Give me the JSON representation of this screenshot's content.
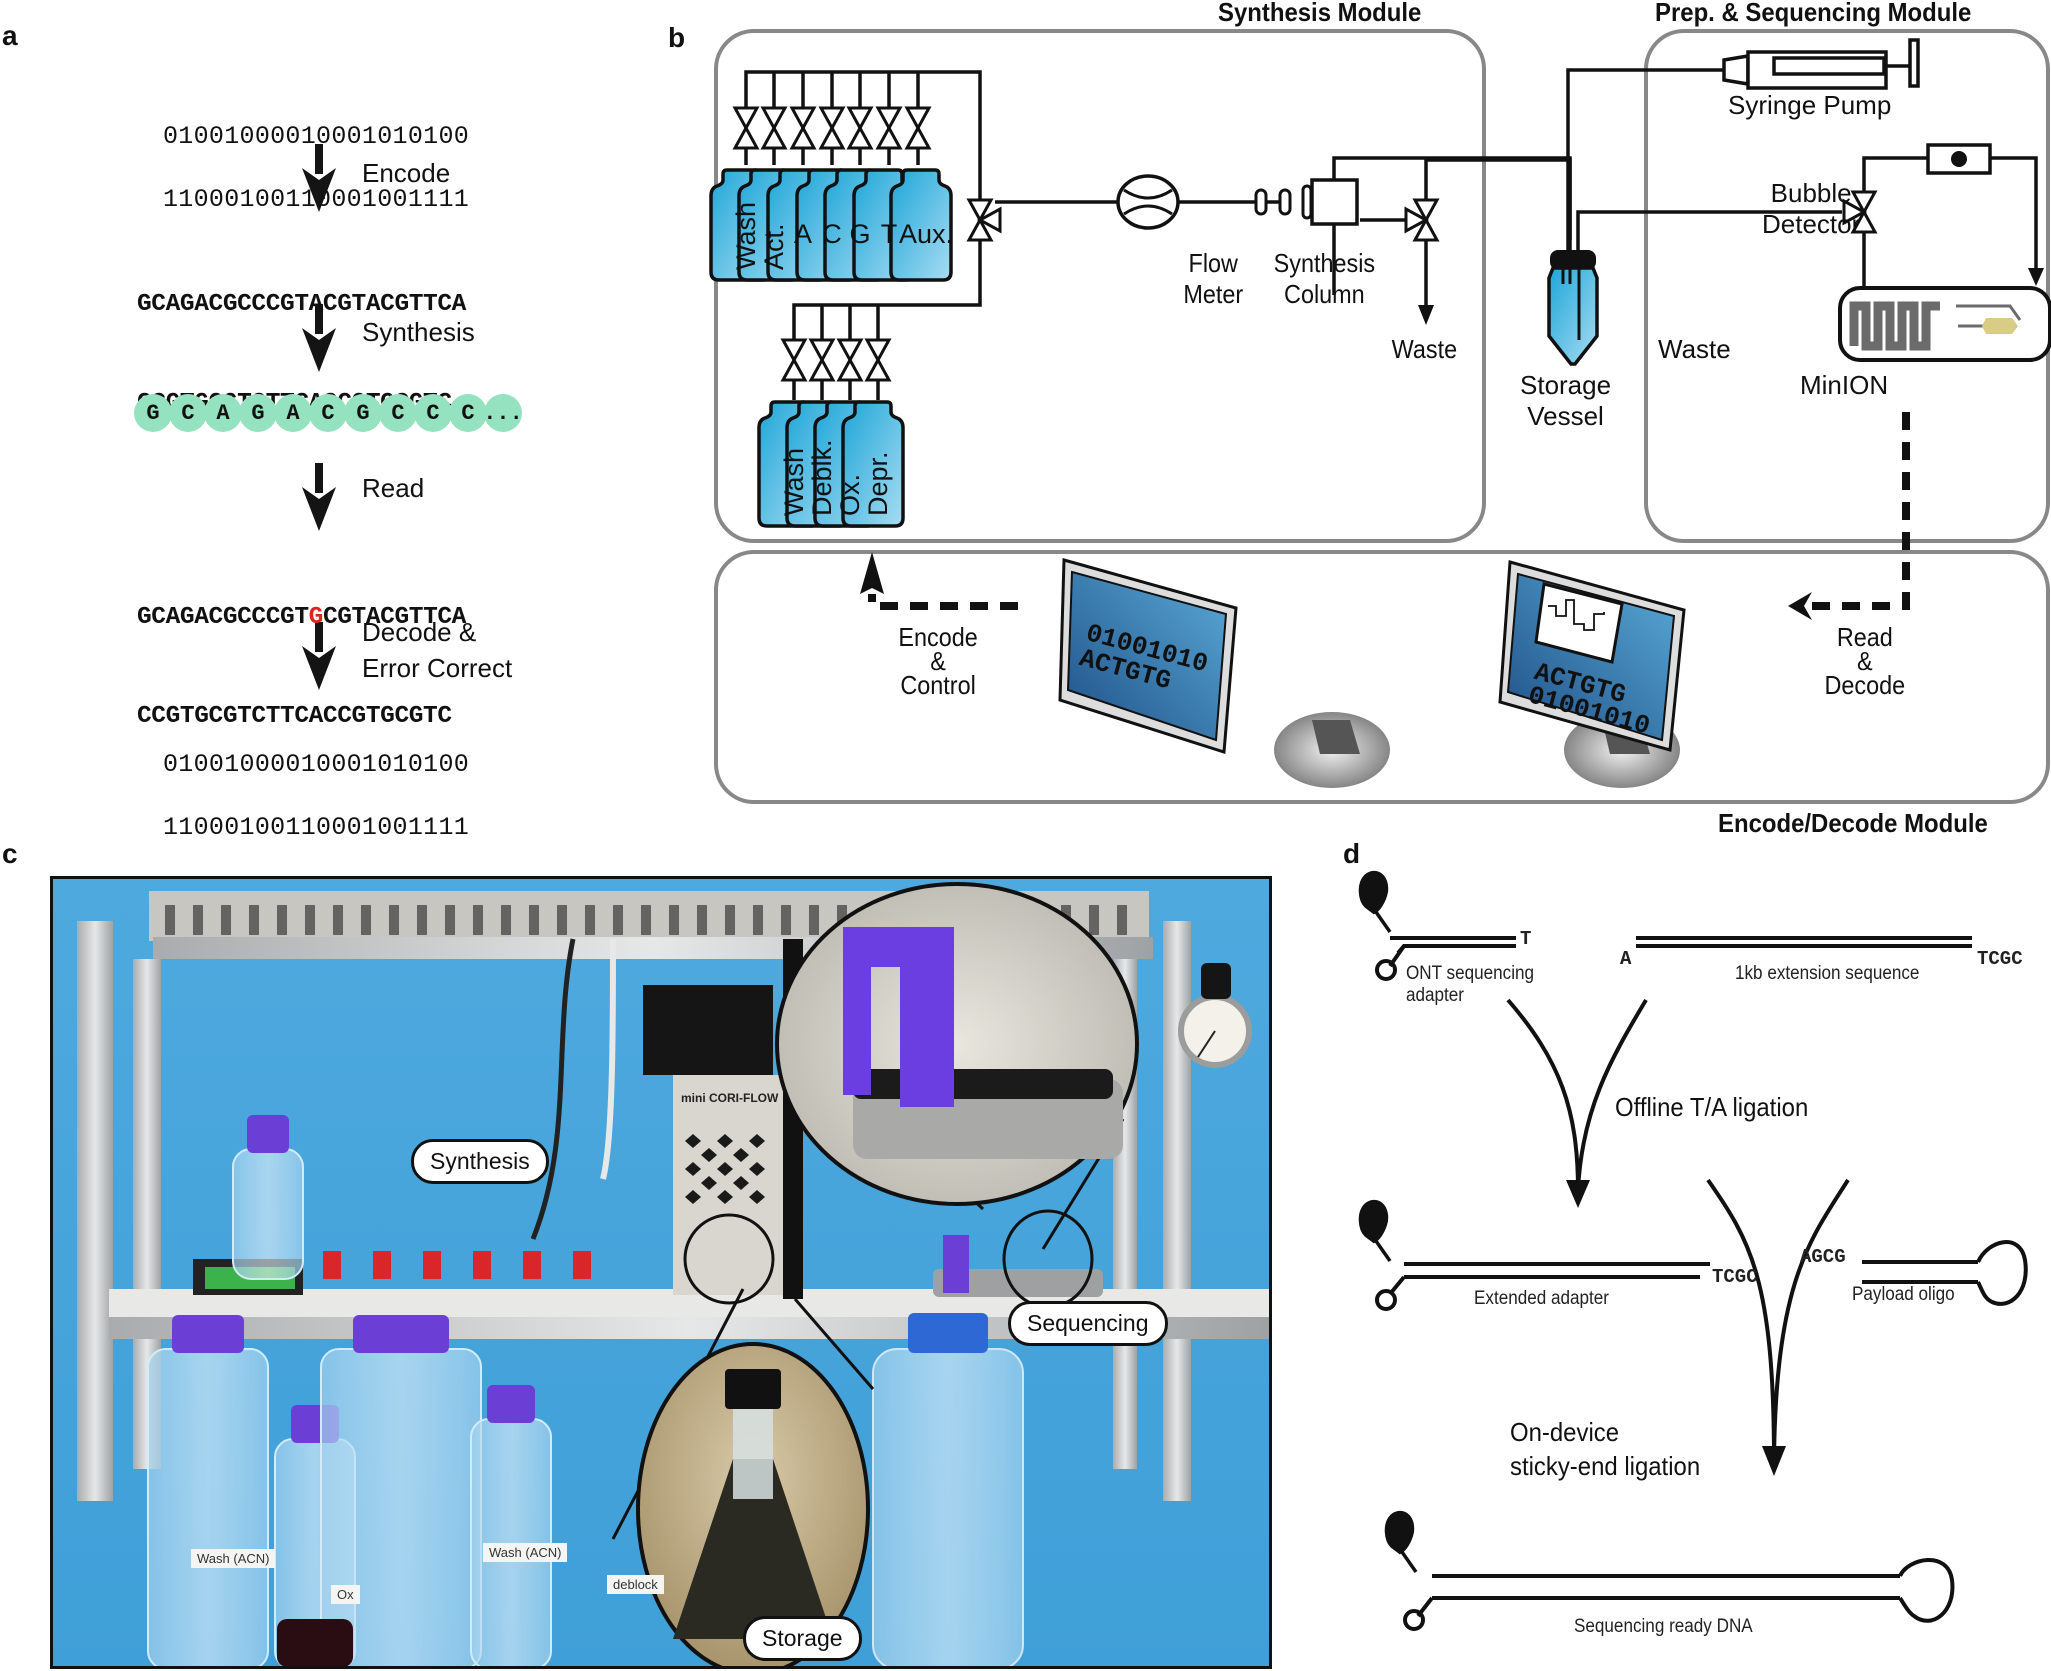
{
  "panels": {
    "a": {
      "letter": "a",
      "input_binary": [
        "01001000010001010100",
        "11000100110001001111"
      ],
      "steps": [
        "Encode",
        "Synthesis",
        "Read",
        "Decode &",
        "Error Correct"
      ],
      "encoded_sequence": [
        "GCAGACGCCCGTACGTACGTTCA",
        "CCGTGCGTCTTCACCGTGCGTC"
      ],
      "synthesized_beads": [
        "G",
        "C",
        "A",
        "G",
        "A",
        "C",
        "G",
        "C",
        "C",
        "C",
        "..."
      ],
      "read_sequence": {
        "line1_before": "GCAGACGCCCGT",
        "line1_error": "G",
        "line1_after": "CGTACGTTCA",
        "line2": "CCGTGCGTCTTCACCGTGCGTC"
      },
      "output_binary": [
        "01001000010001010100",
        "11000100110001001111"
      ],
      "colors": {
        "bead": "#94e2c0",
        "error": "#e2231a"
      }
    },
    "b": {
      "letter": "b",
      "synthesis_module": {
        "title": "Synthesis Module",
        "upper_reagents": [
          "Wash",
          "Act.",
          "A",
          "C",
          "G",
          "T",
          "Aux."
        ],
        "lower_reagents": [
          "Wash",
          "Deblk.",
          "Ox.",
          "Depr."
        ],
        "flow_meter": [
          "Flow",
          "Meter"
        ],
        "synthesis_column": [
          "Synthesis",
          "Column"
        ],
        "waste": "Waste"
      },
      "storage_vessel": [
        "Storage",
        "Vessel"
      ],
      "prep_module": {
        "title": "Prep. & Sequencing  Module",
        "syringe_pump": "Syringe Pump",
        "bubble_detector": [
          "Bubble",
          "Detector"
        ],
        "waste": "Waste",
        "minion": "MinION"
      },
      "encode_decode_module": {
        "title": "Encode/Decode Module",
        "encode_control": [
          "Encode",
          "&",
          "Control"
        ],
        "read_decode": [
          "Read",
          "&",
          "Decode"
        ],
        "left_monitor_text": [
          "01001010",
          "ACTGTG"
        ],
        "right_monitor_text": [
          "ACTGTG",
          "01001010"
        ]
      },
      "colors": {
        "reagent": "#3ab4e0",
        "module_border": "#888888"
      }
    },
    "c": {
      "letter": "c",
      "callouts": [
        "Synthesis",
        "Sequencing",
        "Storage"
      ],
      "bottle_labels": [
        "Wash (ACN)",
        "Ox",
        "Wash (ACN)",
        "deblock"
      ],
      "device_label": "mini CORI-FLOW",
      "colors": {
        "background": "#4aa6dc",
        "cap": "#6b3fd6"
      }
    },
    "d": {
      "letter": "d",
      "row1": {
        "adapter_overhang": "T",
        "adapter_label": [
          "ONT sequencing",
          "adapter"
        ],
        "extension_left": "A",
        "extension_right": "TCGC",
        "extension_label": "1kb extension sequence"
      },
      "step1": "Offline T/A ligation",
      "row2": {
        "adapter_end": "TCGC",
        "adapter_label": "Extended adapter",
        "payload_end": "AGCG",
        "payload_label": "Payload oligo"
      },
      "step2": [
        "On-device",
        "sticky-end ligation"
      ],
      "row3": {
        "label": "Sequencing ready DNA"
      }
    }
  }
}
